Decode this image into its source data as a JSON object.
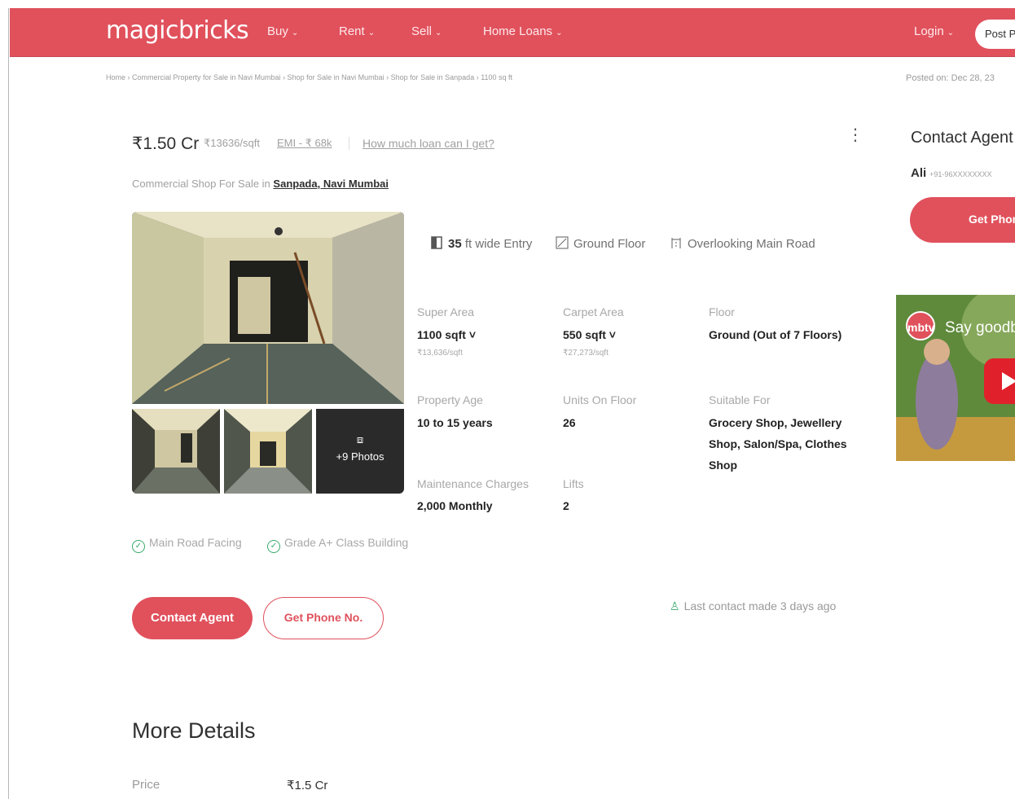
{
  "header": {
    "logo": "magicbricks",
    "nav": [
      {
        "label": "Buy"
      },
      {
        "label": "Rent"
      },
      {
        "label": "Sell"
      },
      {
        "label": "Home Loans"
      }
    ],
    "login_label": "Login",
    "post_label": "Post P"
  },
  "breadcrumb": "Home › Commercial Property for Sale in Navi Mumbai › Shop for Sale in Navi Mumbai › Shop for Sale in Sanpada › 1100 sq ft",
  "posted_on": "Posted on: Dec 28, 23",
  "listing": {
    "price": "₹1.50 Cr",
    "per_sqft": "₹13636/sqft",
    "emi": "EMI - ₹ 68k",
    "loan_link": "How much loan can I get?",
    "kebab": "⋮",
    "subtitle_prefix": "Commercial Shop For Sale in",
    "subtitle_location": "Sanpada, Navi Mumbai",
    "photos_more": "+9 Photos",
    "features": [
      {
        "bold": "35",
        "text": " ft wide Entry"
      },
      {
        "bold": "",
        "text": "Ground Floor"
      },
      {
        "bold": "",
        "text": "Overlooking Main Road"
      }
    ]
  },
  "details": {
    "super_area_label": "Super Area",
    "super_area_value": "1100 sqft ˅",
    "super_area_sub": "₹13,636/sqft",
    "carpet_area_label": "Carpet Area",
    "carpet_area_value": "550 sqft ˅",
    "carpet_area_sub": "₹27,273/sqft",
    "floor_label": "Floor",
    "floor_value": "Ground (Out of 7 Floors)",
    "age_label": "Property Age",
    "age_value": "10 to 15 years",
    "units_label": "Units On Floor",
    "units_value": "26",
    "suitable_label": "Suitable For",
    "suitable_value": "Grocery Shop, Jewellery Shop, Salon/Spa, Clothes Shop",
    "maintenance_label": "Maintenance Charges",
    "maintenance_value": "2,000 Monthly",
    "lifts_label": "Lifts",
    "lifts_value": "2"
  },
  "tags": [
    "Main Road Facing",
    "Grade A+ Class Building"
  ],
  "actions": {
    "contact_agent": "Contact Agent",
    "get_phone": "Get Phone No.",
    "last_contact": "Last contact made 3 days ago"
  },
  "more_details": {
    "title": "More Details",
    "price_label": "Price",
    "price_value": "₹1.5 Cr"
  },
  "sidebar": {
    "title": "Contact Agent",
    "agent_name": "Ali",
    "agent_phone": "+91-96XXXXXXXX",
    "get_phone": "Get Phone",
    "video_logo": "mbtv",
    "video_text": "Say goodbye"
  },
  "colors": {
    "brand": "#e0515c",
    "success": "#3aa86a"
  }
}
